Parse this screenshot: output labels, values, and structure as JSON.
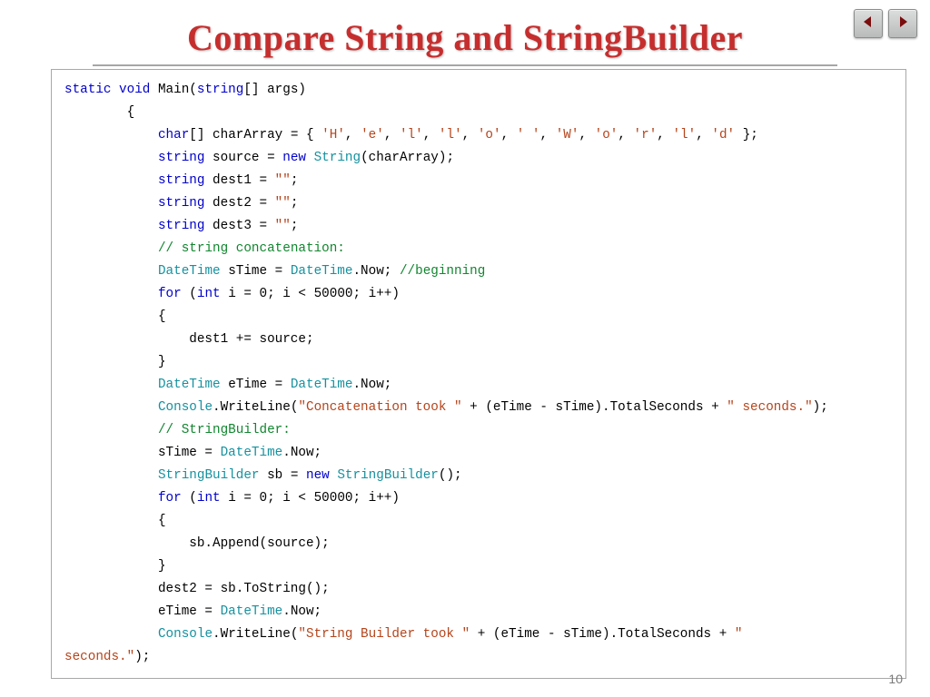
{
  "slide": {
    "title": "Compare String and StringBuilder",
    "page_number": "10"
  },
  "nav": {
    "prev_name": "prev-arrow-icon",
    "next_name": "next-arrow-icon"
  },
  "code": {
    "sig_pre": "static void",
    "sig_mid": " Main(",
    "sig_kw2": "string",
    "sig_post": "[] args)",
    "brace_open": "        {",
    "brace_close": "        }",
    "cl_char": "char",
    "cl_arr_pre": "[] charArray = { ",
    "chars": [
      "'H'",
      "'e'",
      "'l'",
      "'l'",
      "'o'",
      "' '",
      "'W'",
      "'o'",
      "'r'",
      "'l'",
      "'d'"
    ],
    "cl_arr_post": " };",
    "src_kw": "string",
    "src_mid": " source = ",
    "src_new": "new",
    "src_type": "String",
    "src_post": "(charArray);",
    "d1a": "string",
    "d1b": " dest1 = ",
    "d1c": "\"\"",
    "d1d": ";",
    "d2a": "string",
    "d2b": " dest2 = ",
    "d2c": "\"\"",
    "d2d": ";",
    "d3a": "string",
    "d3b": " dest3 = ",
    "d3c": "\"\"",
    "d3d": ";",
    "cmt_concat": "// string concatenation:",
    "dt_type": "DateTime",
    "dt_s_decl": " sTime = ",
    "dt_now": ".Now; ",
    "cmt_begin": "//beginning",
    "for_kw": "for",
    "for_open": " (",
    "int_kw": "int",
    "for_body": " i = 0; i < 50000; i++)",
    "inner_open": "            {",
    "inner_close": "            }",
    "concat_line": "                dest1 += source;",
    "dt_e_decl": " eTime = ",
    "dt_e_post": ".Now;",
    "cw_type": "Console",
    "cw_call": ".WriteLine(",
    "cw_str1": "\"Concatenation took \"",
    "cw_mid": " + (eTime - sTime).TotalSeconds + ",
    "cw_str2": "\" seconds.\"",
    "cw_close": ");",
    "cmt_sb": "// StringBuilder:",
    "stime2": "            sTime = ",
    "stime2b": ".Now;",
    "sb_type": "StringBuilder",
    "sb_decl": " sb = ",
    "sb_new": "new",
    "sb_post": "();",
    "sb_append": "                sb.Append(source);",
    "d2_assign": "            dest2 = sb.ToString();",
    "etime2": "            eTime = ",
    "etime2b": ".Now;",
    "cw2_str1": "\"String Builder took \"",
    "cw2_wrap": "seconds.\"",
    "cw2_wrap_post": ");"
  }
}
